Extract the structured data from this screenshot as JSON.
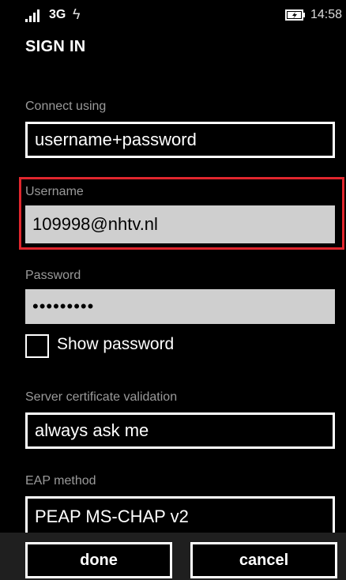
{
  "status_bar": {
    "signal_icon": "signal-strength-icon",
    "network": "3G",
    "data_icon": "data-sync-icon",
    "data_glyph": "ϟ",
    "battery_icon": "battery-charging-icon",
    "time": "14:58"
  },
  "page": {
    "title": "SIGN IN"
  },
  "connect_using": {
    "label": "Connect using",
    "value": "username+password"
  },
  "username": {
    "label": "Username",
    "value": "109998@nhtv.nl"
  },
  "password": {
    "label": "Password",
    "value": "•••••••••"
  },
  "show_password": {
    "label": "Show password",
    "checked": false
  },
  "server_cert": {
    "label": "Server certificate validation",
    "value": "always ask me"
  },
  "eap_method": {
    "label": "EAP method",
    "value": "PEAP MS-CHAP v2"
  },
  "app_bar": {
    "done_label": "done",
    "cancel_label": "cancel"
  },
  "colors": {
    "highlight": "#e0262d",
    "field_light": "#cfcfcf",
    "app_bar": "#1f1f1f"
  }
}
